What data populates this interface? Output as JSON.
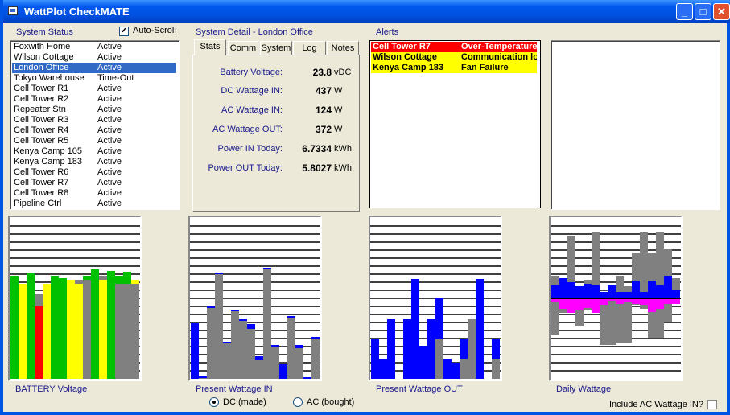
{
  "window": {
    "title": "WattPlot CheckMATE",
    "minimize": "_",
    "maximize": "□",
    "close": "✕"
  },
  "status": {
    "label": "System Status",
    "autoscroll_label": "Auto-Scroll",
    "autoscroll_checked": true,
    "systems": [
      {
        "name": "Foxwith Home",
        "state": "Active"
      },
      {
        "name": "Wilson Cottage",
        "state": "Active"
      },
      {
        "name": "London Office",
        "state": "Active",
        "selected": true
      },
      {
        "name": "Tokyo Warehouse",
        "state": "Time-Out"
      },
      {
        "name": "Cell Tower R1",
        "state": "Active"
      },
      {
        "name": "Cell Tower R2",
        "state": "Active"
      },
      {
        "name": "Repeater Stn",
        "state": "Active"
      },
      {
        "name": "Cell Tower R3",
        "state": "Active"
      },
      {
        "name": "Cell Tower R4",
        "state": "Active"
      },
      {
        "name": "Cell Tower R5",
        "state": "Active"
      },
      {
        "name": "Kenya Camp 105",
        "state": "Active"
      },
      {
        "name": "Kenya Camp 183",
        "state": "Active"
      },
      {
        "name": "Cell Tower R6",
        "state": "Active"
      },
      {
        "name": "Cell Tower R7",
        "state": "Active"
      },
      {
        "name": "Cell Tower R8",
        "state": "Active"
      },
      {
        "name": "Pipeline Ctrl",
        "state": "Active"
      }
    ]
  },
  "detail": {
    "label": "System Detail  -  London Office",
    "tabs": [
      "Stats",
      "Comm",
      "System",
      "Log",
      "Notes"
    ],
    "active_tab": "Stats",
    "stats": [
      {
        "label": "Battery Voltage:",
        "value": "23.8",
        "unit": "vDC"
      },
      {
        "label": "DC Wattage IN:",
        "value": "437",
        "unit": "W"
      },
      {
        "label": "AC Wattage IN:",
        "value": "124",
        "unit": "W"
      },
      {
        "label": "AC Wattage OUT:",
        "value": "372",
        "unit": "W"
      },
      {
        "label": "Power IN Today:",
        "value": "6.7334",
        "unit": "kWh"
      },
      {
        "label": "Power OUT Today:",
        "value": "5.8027",
        "unit": "kWh"
      }
    ]
  },
  "alerts": {
    "label": "Alerts",
    "items": [
      {
        "system": "Cell Tower R7",
        "message": "Over-Temperature",
        "bg": "#ff0000",
        "fg": "#ffffff"
      },
      {
        "system": "Wilson Cottage",
        "message": "Communication lost",
        "bg": "#ffff00",
        "fg": "#000000"
      },
      {
        "system": "Kenya Camp 183",
        "message": "Fan Failure",
        "bg": "#ffff00",
        "fg": "#000000"
      }
    ]
  },
  "colors": {
    "green": "#00c000",
    "yellow": "#ffff00",
    "red": "#ff0000",
    "gray": "#808080",
    "blue": "#0000ff",
    "magenta": "#ff00ff"
  },
  "chart_data": [
    {
      "type": "bar",
      "title": "BATTERY Voltage",
      "scale": "fraction of full scale",
      "bars": [
        {
          "v": 0.64,
          "c": "green"
        },
        {
          "v": 0.59,
          "c": "yellow"
        },
        {
          "v": 0.655,
          "c": "green"
        },
        {
          "v": 0.45,
          "c": "red",
          "peak": 0.525
        },
        {
          "v": 0.59,
          "c": "yellow"
        },
        {
          "v": 0.64,
          "c": "green"
        },
        {
          "v": 0.625,
          "c": "green"
        },
        {
          "v": 0.615,
          "c": "yellow"
        },
        {
          "v": 0.59,
          "c": "yellow",
          "peak": 0.615
        },
        {
          "v": 0.615,
          "c": "gray",
          "peak": 0.64,
          "pc": "green"
        },
        {
          "v": 0.68,
          "c": "green"
        },
        {
          "v": 0.615,
          "c": "yellow",
          "peak": 0.64
        },
        {
          "v": 0.67,
          "c": "green"
        },
        {
          "v": 0.59,
          "c": "gray",
          "peak": 0.64,
          "pc": "green"
        },
        {
          "v": 0.59,
          "c": "gray",
          "peak": 0.665,
          "pc": "green"
        },
        {
          "v": 0.59,
          "c": "gray",
          "peak": 0.615,
          "pc": "yellow"
        }
      ]
    },
    {
      "type": "bar",
      "title": "Present Wattage IN",
      "scale": "fraction of full scale",
      "options": [
        "DC  (made)",
        "AC  (bought)"
      ],
      "selected_option": "DC  (made)",
      "blue": [
        0.35,
        0.01,
        0.44,
        0.66,
        0.23,
        0.41,
        0.35,
        0.34,
        0.14,
        0.69,
        0.21,
        0.09,
        0.39,
        0.21,
        0.01,
        0.26
      ],
      "gray": [
        0,
        0.015,
        0.45,
        0.65,
        0.22,
        0.43,
        0.37,
        0.31,
        0.12,
        0.68,
        0.2,
        0,
        0.38,
        0.19,
        0,
        0.25
      ]
    },
    {
      "type": "bar",
      "title": "Present Wattage OUT",
      "scale": "fraction of full scale",
      "blue": [
        0.25,
        0.125,
        0.37,
        0,
        0.37,
        0.62,
        0.205,
        0.37,
        0.5,
        0.125,
        0.1,
        0.25,
        0,
        0.62,
        0,
        0.25
      ],
      "gray": [
        0,
        0,
        0,
        0,
        0,
        0,
        0,
        0,
        0.25,
        0,
        0,
        0.125,
        0.37,
        0,
        0,
        0.125
      ]
    },
    {
      "type": "bar",
      "title": "Daily Wattage",
      "scale": "fraction of half scale",
      "checkbox_label": "Include AC Wattage IN?",
      "checkbox_checked": false,
      "gray_pos": [
        0.28,
        0.03,
        0.78,
        0.16,
        0.23,
        0.82,
        0.07,
        0.08,
        0.28,
        0.15,
        0.57,
        0.82,
        0.57,
        0.83,
        0.62,
        0.25
      ],
      "blue_pos": [
        0.17,
        0.25,
        0.2,
        0.16,
        0.18,
        0.17,
        0.08,
        0.17,
        0.08,
        0.08,
        0.22,
        0.08,
        0.22,
        0.17,
        0.28,
        0.11
      ],
      "magenta_neg": [
        0.04,
        0.13,
        0.18,
        0.15,
        0.12,
        0.18,
        0.08,
        0.03,
        0.07,
        0.05,
        0.07,
        0.08,
        0.17,
        0.13,
        0.07,
        0.07
      ],
      "gray_neg": [
        0.45,
        0.18,
        0.18,
        0.34,
        0.15,
        0.13,
        0.58,
        0.58,
        0.55,
        0.55,
        0.08,
        0.13,
        0.49,
        0.49,
        0.29,
        0.05
      ]
    }
  ]
}
